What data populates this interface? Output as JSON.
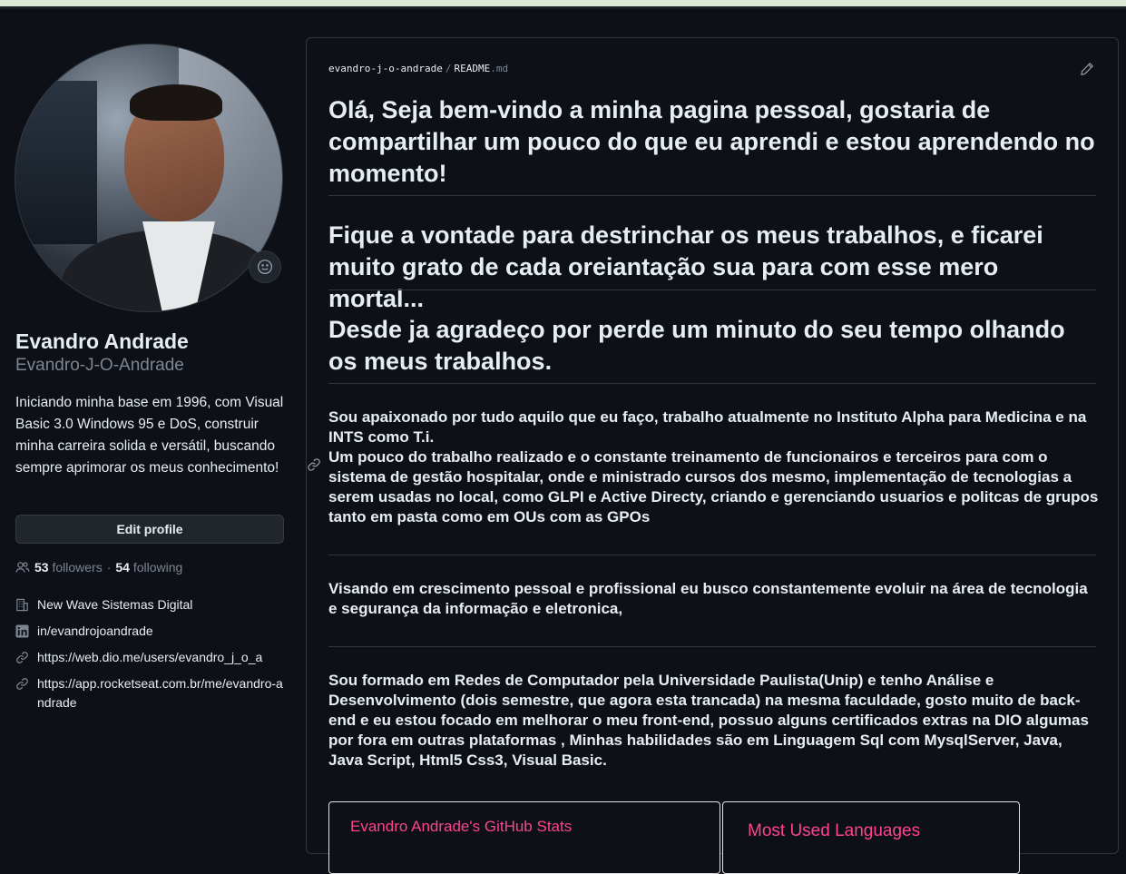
{
  "sidebar": {
    "full_name": "Evandro Andrade",
    "username": "Evandro-J-O-Andrade",
    "bio": "Iniciando minha base em 1996, com Visual Basic 3.0 Windows 95 e DoS, construir minha carreira solida e versátil, buscando sempre aprimorar os meus conhecimento!",
    "edit_profile_label": "Edit profile",
    "followers_count": "53",
    "followers_label": "followers",
    "following_count": "54",
    "following_label": "following",
    "company": "New Wave Sistemas Digital",
    "linkedin": "in/evandrojoandrade",
    "link1": "https://web.dio.me/users/evandro_j_o_a",
    "link2": "https://app.rocketseat.com.br/me/evandro-andrade"
  },
  "readme": {
    "breadcrumb_repo": "evandro-j-o-andrade",
    "breadcrumb_sep": "/",
    "breadcrumb_file": "README",
    "breadcrumb_ext": ".md",
    "heading1": "Olá, Seja bem-vindo a minha pagina pessoal, gostaria de compartilhar um pouco do que eu aprendi e estou aprendendo no momento!",
    "heading2": "Fique a vontade para destrinchar os meus trabalhos, e ficarei muito grato de cada oreiantação sua para com esse mero mortal...",
    "heading3": "Desde ja agradeço por perde um minuto do seu tempo olhando os meus trabalhos.",
    "para1": "Sou apaixonado por tudo aquilo que eu faço, trabalho atualmente no Instituto Alpha para Medicina e na INTS como T.i.\nUm pouco do trabalho realizado e o constante treinamento de funcionairos e terceiros para com o sistema de gestão hospitalar, onde e ministrado cursos dos mesmo, implementação de tecnologias a serem usadas no local, como GLPI e Active Directy, criando e gerenciando usuarios e politcas de grupos tanto em pasta como em OUs com as GPOs",
    "para2": "Visando em crescimento pessoal e profissional eu busco constantemente evoluir na área de tecnologia e segurança da informação e eletronica,",
    "para3": "Sou formado em Redes de Computador pela Universidade Paulista(Unip) e tenho Análise e Desenvolvimento (dois semestre, que agora esta trancada) na mesma faculdade, gosto muito de back-end e eu estou focado em melhorar o meu front-end, possuo alguns certificados extras na DIO algumas por fora em outras plataformas , Minhas habilidades são em Linguagem Sql com MysqlServer, Java, Java Script, Html5 Css3, Visual Basic.",
    "stats_card_title": "Evandro Andrade's GitHub Stats",
    "langs_card_title": "Most Used Languages"
  },
  "colors": {
    "accent_pink": "#fe428e",
    "background": "#0d1117",
    "border": "#30363d"
  }
}
